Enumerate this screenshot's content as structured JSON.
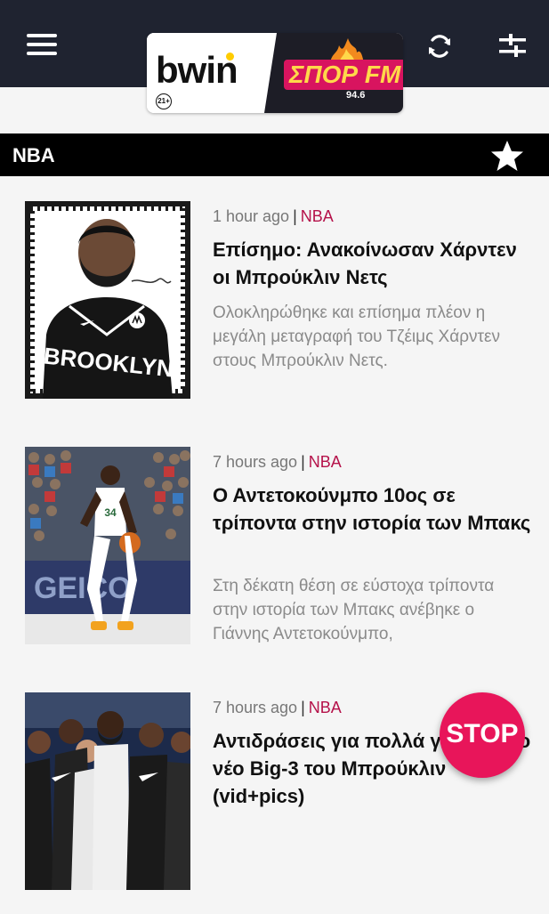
{
  "header": {
    "menu_icon": "hamburger-menu-icon",
    "logo": {
      "brand_left": "bwin",
      "age_badge": "21+",
      "brand_right": "ΣΠΟΡ FM",
      "frequency": "94.6"
    },
    "refresh_icon": "refresh-icon",
    "filter_icon": "sliders-icon",
    "background_color": "#1f2330"
  },
  "section": {
    "title": "NBA",
    "favorite_icon": "star-icon"
  },
  "articles": [
    {
      "time": "1 hour ago",
      "category": "NBA",
      "headline": "Επίσημο: Ανακοίνωσαν Χάρντεν οι Μπρούκλιν Νετς",
      "summary": "Ολοκληρώθηκε και επίσημα πλέον η μεγάλη μεταγραφή του Τζέιμς Χάρντεν στους Μπρούκλιν Νετς.",
      "image_label": "BROOKLYN"
    },
    {
      "time": "7 hours ago",
      "category": "NBA",
      "headline": "Ο Αντετοκούνμπο 10ος σε τρίποντα στην ιστορία των Μπακς",
      "summary": "Στη δέκατη θέση σε εύστοχα τρίποντα στην ιστορία των Μπακς ανέβηκε ο Γιάννης Αντετοκούνμπο,",
      "image_label": "GEICO"
    },
    {
      "time": "7 hours ago",
      "category": "NBA",
      "headline": "Αντιδράσεις για πολλά γέλια με το νέο Big-3 του Μπρούκλιν (vid+pics)",
      "summary": "",
      "image_label": ""
    }
  ],
  "stop_button": {
    "label": "STOP",
    "color": "#e8155a"
  },
  "accent_color": "#b5124a"
}
